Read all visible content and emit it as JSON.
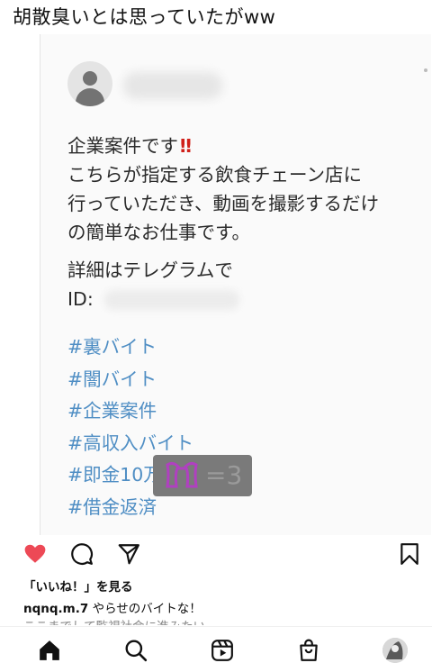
{
  "caption": "胡散臭いとは思っていたがww",
  "post": {
    "text_lines": [
      "企業案件です",
      "こちらが指定する飲食チェーン店に",
      "行っていただき、動画を撮影するだけ",
      "の簡単なお仕事です。",
      "詳細はテレグラムで",
      "ID:"
    ],
    "bang": "‼",
    "hashtags": [
      "#裏バイト",
      "#闇バイト",
      "#企業案件",
      "#高収入バイト",
      "#即金10万円",
      "#借金返済"
    ],
    "sticker_emoticon": "=3"
  },
  "actions": {
    "like_icon": "heart-icon",
    "comment_icon": "comment-icon",
    "share_icon": "share-icon",
    "save_icon": "bookmark-icon",
    "like_color": "#ed4956"
  },
  "likes_label": "「いいね！」を見る",
  "comment": {
    "user": "nqnq.m.7",
    "text": " やらせのバイトな！"
  },
  "comment_faded": "ここまでして監視社会に進みたい",
  "nav": [
    "home-icon",
    "search-icon",
    "reels-icon",
    "shop-icon",
    "profile-avatar"
  ]
}
